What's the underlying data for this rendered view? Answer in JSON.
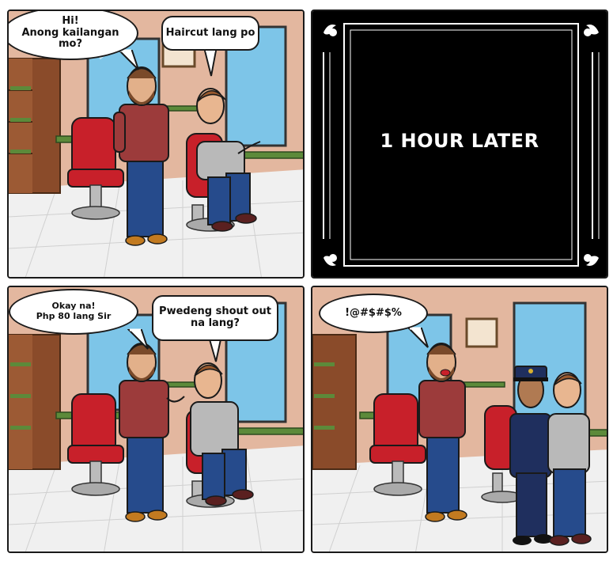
{
  "panel1": {
    "bubble_left": "Hi!\nAnong kailangan\nmo?",
    "bubble_right": "Haircut lang po"
  },
  "panel2": {
    "caption": "1 HOUR LATER"
  },
  "panel3": {
    "bubble_left": "Okay na!\nPhp 80 lang Sir",
    "bubble_right": "Pwedeng shout out\nna lang?"
  },
  "panel4": {
    "bubble_left": "!@#$#$%"
  },
  "colors": {
    "wall": "#e3b79f",
    "floor": "#f2f2f2",
    "chair_red": "#c8202a",
    "border": "#1a1a1a",
    "title_bg": "#000000"
  }
}
